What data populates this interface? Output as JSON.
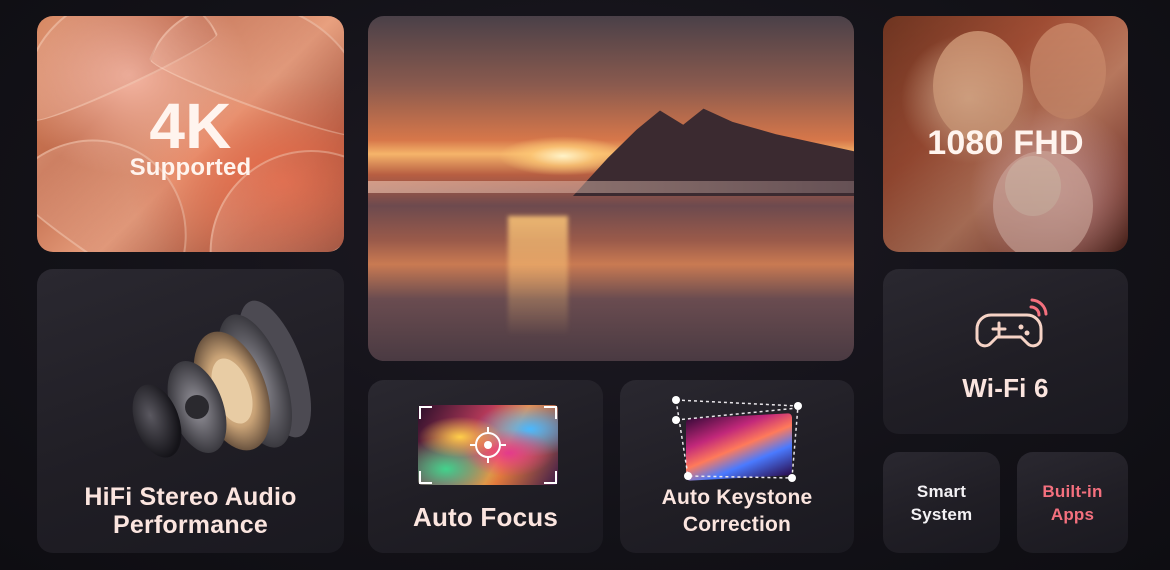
{
  "tiles": {
    "k4": {
      "title": "4K",
      "subtitle": "Supported"
    },
    "fhd": {
      "title": "1080 FHD"
    },
    "audio": {
      "line1": "HiFi Stereo Audio",
      "line2": "Performance"
    },
    "wifi": {
      "title": "Wi-Fi 6",
      "icon": "gamepad-icon"
    },
    "focus": {
      "title": "Auto Focus",
      "icon": "focus-target-icon"
    },
    "keystone": {
      "line1": "Auto Keystone",
      "line2": "Correction"
    },
    "smart": {
      "line1": "Smart",
      "line2": "System"
    },
    "apps": {
      "line1": "Built-in",
      "line2": "Apps"
    }
  },
  "colors": {
    "caption": "#fbe5df",
    "accent_pink": "#f4707e",
    "background": "#131218"
  }
}
